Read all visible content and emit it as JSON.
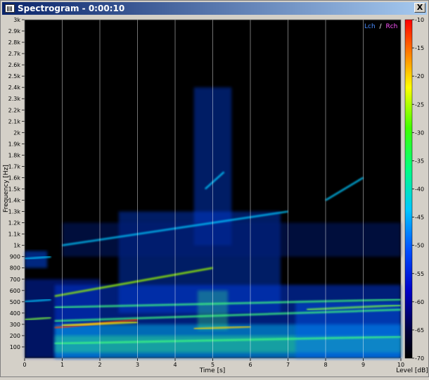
{
  "window": {
    "title": "Spectrogram - 0:00:10",
    "close_label": "X"
  },
  "chart_data": {
    "type": "heatmap",
    "xlabel": "Time [s]",
    "ylabel": "Frequency [Hz]",
    "colorbar_label": "Level [dB]",
    "xlim": [
      0,
      10
    ],
    "ylim": [
      0,
      3000
    ],
    "clim": [
      -70,
      -10
    ],
    "x_ticks": [
      "0",
      "1",
      "2",
      "3",
      "4",
      "5",
      "6",
      "7",
      "8",
      "9",
      "10"
    ],
    "y_ticks": [
      "100",
      "200",
      "300",
      "400",
      "500",
      "600",
      "700",
      "800",
      "900",
      "1k",
      "1.1k",
      "1.2k",
      "1.3k",
      "1.4k",
      "1.5k",
      "1.6k",
      "1.7k",
      "1.8k",
      "1.9k",
      "2k",
      "2.1k",
      "2.2k",
      "2.3k",
      "2.4k",
      "2.5k",
      "2.6k",
      "2.7k",
      "2.8k",
      "2.9k",
      "3k"
    ],
    "colorbar_ticks": [
      "-10",
      "-15",
      "-20",
      "-25",
      "-30",
      "-35",
      "-40",
      "-45",
      "-50",
      "-55",
      "-60",
      "-65",
      "-70"
    ],
    "legend": {
      "left": "Lch",
      "sep": "/",
      "right": "Rch",
      "left_color": "#4a8cff",
      "right_color": "#ff55ff"
    },
    "gridlines_x": true
  }
}
